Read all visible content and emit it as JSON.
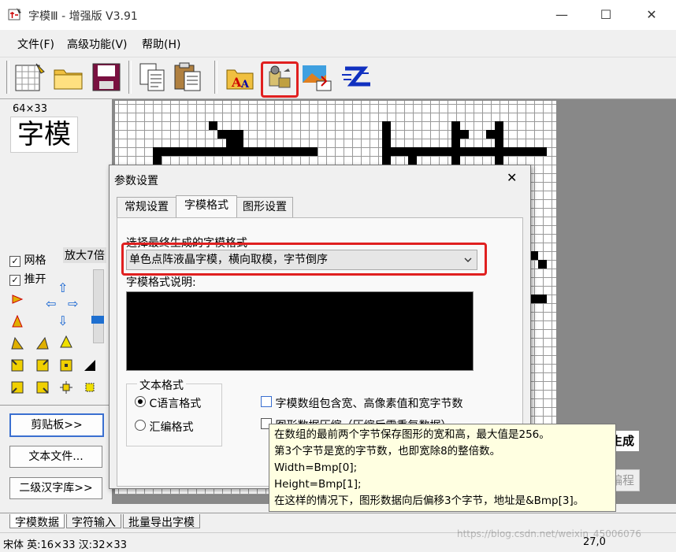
{
  "window": {
    "title": "字模Ⅲ - 增强版 V3.91",
    "minimize": "—",
    "maximize": "☐",
    "close": "✕"
  },
  "menu": [
    "文件(F)",
    "高级功能(V)",
    "帮助(H)"
  ],
  "toolbar": {
    "icons": [
      "new-image-icon",
      "open-folder-icon",
      "save-disk-icon",
      "copy-icon",
      "paste-icon",
      "font-style-icon",
      "parameter-settings-icon",
      "import-image-icon",
      "encode-icon"
    ],
    "highlight": "parameter-settings-icon"
  },
  "left_panel": {
    "size": "64×33",
    "preview_text": "字模",
    "grid_label": "网格",
    "grid_checked": true,
    "push_label": "推开",
    "push_checked": true,
    "zoom_label": "放大7倍",
    "buttons": [
      "剪贴板>>",
      "文本文件...",
      "二级汉字库>>"
    ]
  },
  "dialog": {
    "title": "参数设置",
    "close": "✕",
    "tabs": [
      "常规设置",
      "字模格式",
      "图形设置"
    ],
    "active_tab": 1,
    "select_label": "选择最终生成的字模格式",
    "select_value": "单色点阵液晶字模，横向取模，字节倒序",
    "desc_label": "字模格式说明:",
    "text_format_group": "文本格式",
    "radio_c": "C语言格式",
    "radio_c_checked": true,
    "radio_asm": "汇编格式",
    "checkbox_include_size": "字模数组包含宽、高像素值和宽字节数",
    "checkbox_compress": "图形数据压缩（压缩后需重复数据）"
  },
  "tooltip": [
    "在数组的最前两个字节保存图形的宽和高，最大值是256。",
    "第3个字节是宽的字节数，也即宽除8的整倍数。",
    "Width=Bmp[0];",
    "Height=Bmp[1];",
    "在这样的情况下，图形数据向后偏移3个字节，地址是&Bmp[3]。"
  ],
  "right_buttons": [
    "生成",
    "编程"
  ],
  "bottom_tabs": [
    "字模数据",
    "字符输入",
    "批量导出字模"
  ],
  "status": {
    "font": "宋体 英:16×33 汉:32×33",
    "coord": "27,0",
    "watermark": "https://blog.csdn.net/weixin_45006076"
  },
  "colors": {
    "highlight_red": "#e02020",
    "tooltip_bg": "#ffffe1",
    "description_bg": "#000000"
  }
}
